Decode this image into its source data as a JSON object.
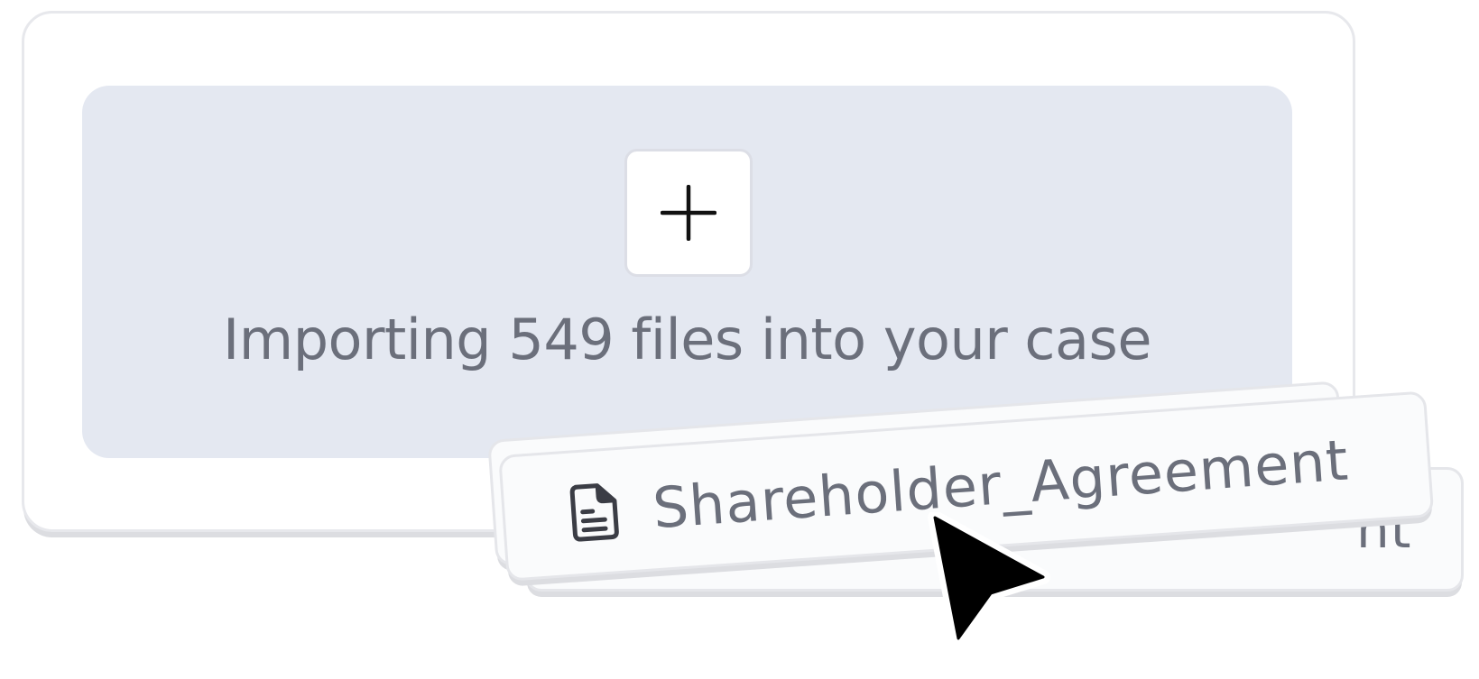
{
  "upload": {
    "status_text": "Importing 549 files into your case"
  },
  "files": {
    "front_chip_name": "Shareholder_Agreement",
    "back_chip_name_fragment": "nt"
  },
  "icons": {
    "add": "plus-icon",
    "file": "document-icon",
    "pointer": "mouse-cursor-icon"
  },
  "colors": {
    "dropzone": "#e4e8f1",
    "text": "#6b6f7b"
  }
}
